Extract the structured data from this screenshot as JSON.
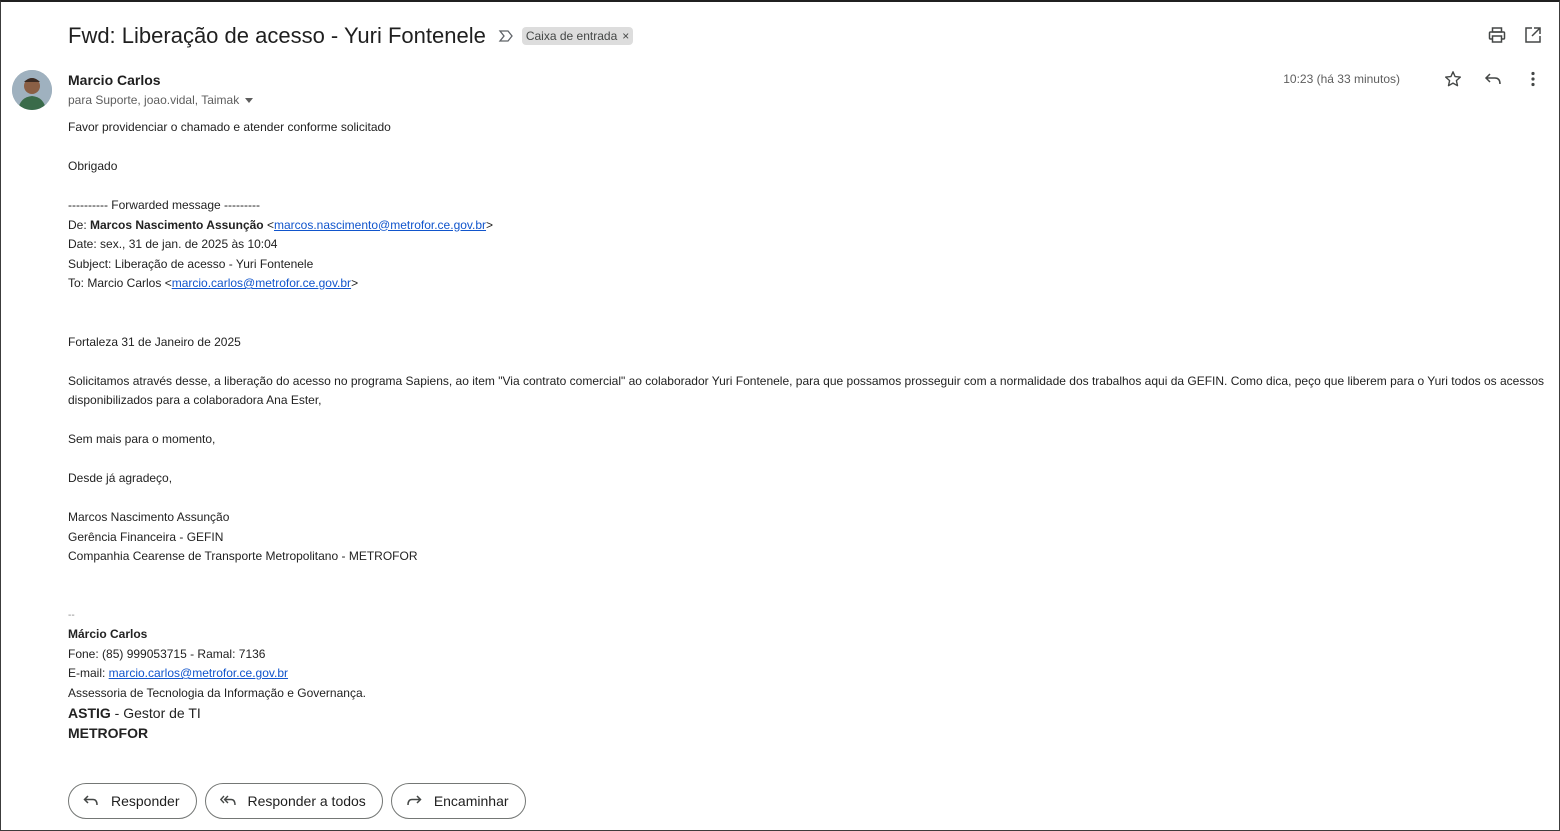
{
  "email": {
    "subject": "Fwd: Liberação de acesso - Yuri Fontenele",
    "label": "Caixa de entrada",
    "label_remove": "×",
    "sender_name": "Marcio Carlos",
    "recipients": "para Suporte, joao.vidal, Taimak",
    "timestamp": "10:23 (há 33 minutos)"
  },
  "body": {
    "line1": "Favor providenciar o chamado e atender conforme solicitado",
    "line2": "Obrigado",
    "fwd_header": "---------- Forwarded message ---------",
    "from_prefix": "De: ",
    "from_name": "Marcos Nascimento Assunção",
    "from_open": " <",
    "from_email": "marcos.nascimento@metrofor.ce.gov.br",
    "from_close": ">",
    "date": "Date: sex., 31 de jan. de 2025 às 10:04",
    "subject": "Subject: Liberação de acesso - Yuri Fontenele",
    "to_prefix": "To: Marcio Carlos <",
    "to_email": "marcio.carlos@metrofor.ce.gov.br",
    "to_close": ">",
    "place_date": "Fortaleza 31 de Janeiro de 2025",
    "request": "Solicitamos através desse, a liberação do acesso no programa Sapiens, ao item \"Via contrato comercial\" ao colaborador Yuri Fontenele, para que possamos prosseguir com a normalidade dos trabalhos aqui da GEFIN. Como dica, peço que liberem para o Yuri todos os acessos disponibilizados para a colaboradora Ana Ester,",
    "closing1": "Sem mais para o momento,",
    "closing2": "Desde já agradeço,",
    "sign_name": "Marcos Nascimento Assunção",
    "sign_dept": "Gerência Financeira - GEFIN",
    "sign_company": "Companhia Cearense de Transporte Metropolitano - METROFOR"
  },
  "signature": {
    "dash": "--",
    "name": "Márcio Carlos",
    "phone": "Fone: (85) 999053715 - Ramal: 7136",
    "email_prefix": "E-mail: ",
    "email": "marcio.carlos@metrofor.ce.gov.br",
    "department": "Assessoria de Tecnologia da Informação e Governança.",
    "role_bold": "ASTIG",
    "role_rest": " - Gestor de TI",
    "org": "METROFOR"
  },
  "actions": {
    "reply": "Responder",
    "reply_all": "Responder a todos",
    "forward": "Encaminhar"
  },
  "icons": [
    "important-marker-icon",
    "print-icon",
    "open-new-window-icon",
    "star-icon",
    "reply-icon",
    "more-vert-icon",
    "reply-all-icon",
    "forward-icon"
  ]
}
